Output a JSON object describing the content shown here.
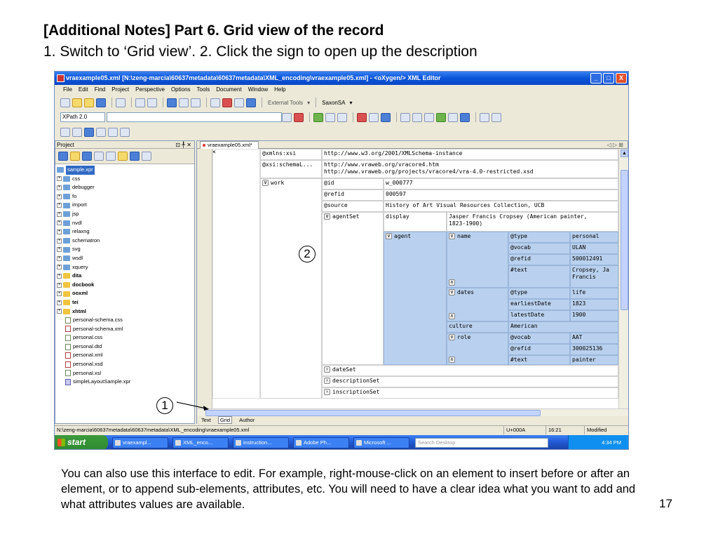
{
  "slide": {
    "title": "[Additional Notes] Part 6. Grid view of the record",
    "subtitle": "1. Switch to ‘Grid view’.  2. Click the sign to open up the description",
    "caption": "You can also use this interface to edit.  For example, right-mouse-click on an element to insert before or after an element, or to append sub-elements, attributes, etc.  You will need to have a clear idea what you want to add and what attributes values are available.",
    "page_number": "17",
    "callouts": [
      "1",
      "2"
    ]
  },
  "window": {
    "title": "vraexample05.xml [N:\\zeng-marcia\\60637metadata\\60637metadata\\XML_encoding\\vraexample05.xml] - <oXygen/> XML Editor",
    "controls": [
      "_",
      "□",
      "X"
    ]
  },
  "menu": [
    "File",
    "Edit",
    "Find",
    "Project",
    "Perspective",
    "Options",
    "Tools",
    "Document",
    "Window",
    "Help"
  ],
  "toolbar": {
    "external_tools": "External Tools",
    "transformer": "SaxonSA",
    "xpath_label": "XPath 2.0"
  },
  "project": {
    "header": "Project",
    "header_controls": "⊡ ╀ ✕",
    "items": [
      {
        "label": "sample.xpr",
        "kind": "root"
      },
      {
        "label": "css",
        "kind": "folder"
      },
      {
        "label": "debugger",
        "kind": "folder"
      },
      {
        "label": "fo",
        "kind": "folder"
      },
      {
        "label": "import",
        "kind": "folder"
      },
      {
        "label": "jsp",
        "kind": "folder"
      },
      {
        "label": "nvdl",
        "kind": "folder"
      },
      {
        "label": "relaxng",
        "kind": "folder"
      },
      {
        "label": "schematron",
        "kind": "folder"
      },
      {
        "label": "svg",
        "kind": "folder"
      },
      {
        "label": "wsdl",
        "kind": "folder"
      },
      {
        "label": "xquery",
        "kind": "folder"
      },
      {
        "label": "dita",
        "kind": "folder-bold"
      },
      {
        "label": "docbook",
        "kind": "folder-bold"
      },
      {
        "label": "ooxml",
        "kind": "folder-bold"
      },
      {
        "label": "tei",
        "kind": "folder-bold"
      },
      {
        "label": "xhtml",
        "kind": "folder-bold"
      },
      {
        "label": "personal-schema.css",
        "kind": "file"
      },
      {
        "label": "personal-schema.xml",
        "kind": "file-x"
      },
      {
        "label": "personal.css",
        "kind": "file"
      },
      {
        "label": "personal.dtd",
        "kind": "file"
      },
      {
        "label": "personal.xml",
        "kind": "file-x"
      },
      {
        "label": "personal.xsd",
        "kind": "file-x"
      },
      {
        "label": "personal.xsl",
        "kind": "file"
      },
      {
        "label": "simpleLayoutSample.xpr",
        "kind": "file-p"
      }
    ]
  },
  "editor": {
    "tab": "vraexample05.xml*",
    "tab_close": "✕",
    "tab_nav": "◁ ▷ ⊞",
    "modes": [
      "Text",
      "Grid",
      "Author"
    ],
    "active_mode": "Grid",
    "grid": {
      "xmlns_xsi": "@xmlns:xsi",
      "xmlns_xsi_val": "http://www.w3.org/2001/XMLSchema-instance",
      "schema_loc": "@xsi:schemaL...",
      "schema_loc_val1": "http://www.vraweb.org/vracore4.htm",
      "schema_loc_val2": "http://www.vraweb.org/projects/vracore4/vra-4.0-restricted.xsd",
      "work": "work",
      "id": "@id",
      "id_val": "w_000777",
      "refid": "@refid",
      "refid_val": "000597",
      "source": "@source",
      "source_val": "History of Art Visual Resources Collection, UCB",
      "agentSet": "agentSet",
      "display": "display",
      "display_val1": "Jasper Francis Cropsey (American painter,",
      "display_val2": "1823-1900)",
      "agent": "agent",
      "name": "name",
      "type": "@type",
      "type_val": "personal",
      "vocab": "@vocab",
      "vocab_val": "ULAN",
      "name_refid": "@refid",
      "name_refid_val": "500012491",
      "text": "#text",
      "text_val1": "Cropsey, Ja",
      "text_val2": "Francis",
      "dates": "dates",
      "dates_type": "@type",
      "dates_type_val": "life",
      "earliest": "earliestDate",
      "earliest_val": "1823",
      "latest": "latestDate",
      "latest_val": "1900",
      "culture": "culture",
      "culture_val": "American",
      "role": "role",
      "role_vocab": "@vocab",
      "role_vocab_val": "AAT",
      "role_refid": "@refid",
      "role_refid_val": "300025136",
      "role_text": "#text",
      "role_text_val": "painter",
      "dateSet": "dateSet",
      "descriptionSet": "descriptionSet",
      "inscriptionSet": "inscriptionSet"
    }
  },
  "status": {
    "path": "N:\\zeng-marcia\\60637metadata\\60637metadata\\XML_encoding\\vraexample05.xml",
    "encoding": "U+000A",
    "position": "16:21",
    "state": "Modified"
  },
  "taskbar": {
    "start": "start",
    "tasks": [
      "vraexampl...",
      "XML_enco...",
      "instruction...",
      "Adobe Ph...",
      "Microsoft ..."
    ],
    "search_placeholder": "Search Desktop",
    "clock": "4:34 PM"
  },
  "colors": {
    "titlebar": "#0a54d8",
    "highlight": "#b9d1ee",
    "start": "#2f8a2f"
  }
}
